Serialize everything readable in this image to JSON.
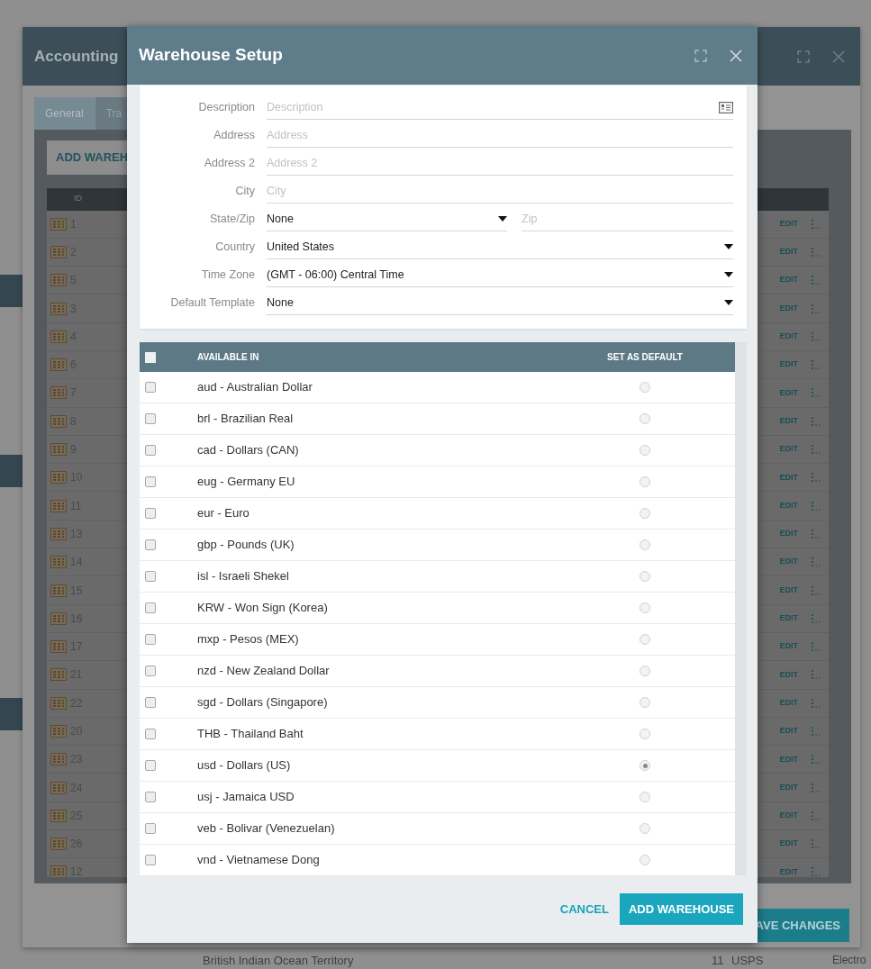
{
  "background_window": {
    "title": "Accounting",
    "tabs": [
      {
        "label": "General",
        "selected": true
      },
      {
        "label": "Tra",
        "selected": false
      }
    ],
    "add_button": "ADD WAREH",
    "table": {
      "columns": [
        "ID"
      ],
      "rows": [
        {
          "id": "1",
          "action": "EDIT"
        },
        {
          "id": "2",
          "action": "EDIT"
        },
        {
          "id": "5",
          "action": "EDIT"
        },
        {
          "id": "3",
          "action": "EDIT"
        },
        {
          "id": "4",
          "action": "EDIT"
        },
        {
          "id": "6",
          "action": "EDIT"
        },
        {
          "id": "7",
          "action": "EDIT"
        },
        {
          "id": "8",
          "action": "EDIT"
        },
        {
          "id": "9",
          "action": "EDIT"
        },
        {
          "id": "10",
          "action": "EDIT"
        },
        {
          "id": "11",
          "action": "EDIT"
        },
        {
          "id": "13",
          "action": "EDIT"
        },
        {
          "id": "14",
          "action": "EDIT"
        },
        {
          "id": "15",
          "action": "EDIT"
        },
        {
          "id": "16",
          "action": "EDIT"
        },
        {
          "id": "17",
          "action": "EDIT"
        },
        {
          "id": "21",
          "action": "EDIT"
        },
        {
          "id": "22",
          "action": "EDIT"
        },
        {
          "id": "20",
          "action": "EDIT"
        },
        {
          "id": "23",
          "action": "EDIT"
        },
        {
          "id": "24",
          "action": "EDIT"
        },
        {
          "id": "25",
          "action": "EDIT"
        },
        {
          "id": "26",
          "action": "EDIT"
        },
        {
          "id": "12",
          "action": "EDIT"
        }
      ]
    },
    "save_button": "AVE CHANGES",
    "below": {
      "country": "British Indian Ocean Territory",
      "number": "11",
      "carrier": "USPS",
      "method": "Electro"
    }
  },
  "dialog": {
    "title": "Warehouse Setup",
    "fields": [
      {
        "label": "Description",
        "kind": "text_icon",
        "placeholder": "Description"
      },
      {
        "label": "Address",
        "kind": "text",
        "placeholder": "Address"
      },
      {
        "label": "Address 2",
        "kind": "text",
        "placeholder": "Address 2"
      },
      {
        "label": "City",
        "kind": "text",
        "placeholder": "City"
      },
      {
        "label": "State/Zip",
        "kind": "select_zip",
        "value": "None",
        "placeholder": "Zip"
      },
      {
        "label": "Country",
        "kind": "select",
        "value": "United States"
      },
      {
        "label": "Time Zone",
        "kind": "select",
        "value": "(GMT - 06:00) Central Time"
      },
      {
        "label": "Default Template",
        "kind": "select",
        "value": "None"
      }
    ],
    "currency_table": {
      "all_checked": false,
      "columns": [
        "AVAILABLE IN",
        "SET AS DEFAULT"
      ],
      "rows": [
        {
          "name": "aud - Australian Dollar",
          "checked": false,
          "selected": false
        },
        {
          "name": "brl - Brazilian Real",
          "checked": false,
          "selected": false
        },
        {
          "name": "cad - Dollars (CAN)",
          "checked": false,
          "selected": false
        },
        {
          "name": "eug - Germany EU",
          "checked": false,
          "selected": false
        },
        {
          "name": "eur - Euro",
          "checked": false,
          "selected": false
        },
        {
          "name": "gbp - Pounds (UK)",
          "checked": false,
          "selected": false
        },
        {
          "name": "isl - Israeli Shekel",
          "checked": false,
          "selected": false
        },
        {
          "name": "KRW - Won Sign (Korea)",
          "checked": false,
          "selected": false
        },
        {
          "name": "mxp - Pesos (MEX)",
          "checked": false,
          "selected": false
        },
        {
          "name": "nzd - New Zealand Dollar",
          "checked": false,
          "selected": false
        },
        {
          "name": "sgd - Dollars (Singapore)",
          "checked": false,
          "selected": false
        },
        {
          "name": "THB - Thailand Baht",
          "checked": false,
          "selected": false
        },
        {
          "name": "usd - Dollars (US)",
          "checked": false,
          "selected": true
        },
        {
          "name": "usj - Jamaica USD",
          "checked": false,
          "selected": false
        },
        {
          "name": "veb - Bolivar (Venezuelan)",
          "checked": false,
          "selected": false
        },
        {
          "name": "vnd - Vietnamese Dong",
          "checked": false,
          "selected": false
        }
      ]
    },
    "buttons": [
      {
        "label": "CANCEL",
        "kind": "link"
      },
      {
        "label": "ADD WAREHOUSE",
        "kind": "primary"
      }
    ]
  }
}
